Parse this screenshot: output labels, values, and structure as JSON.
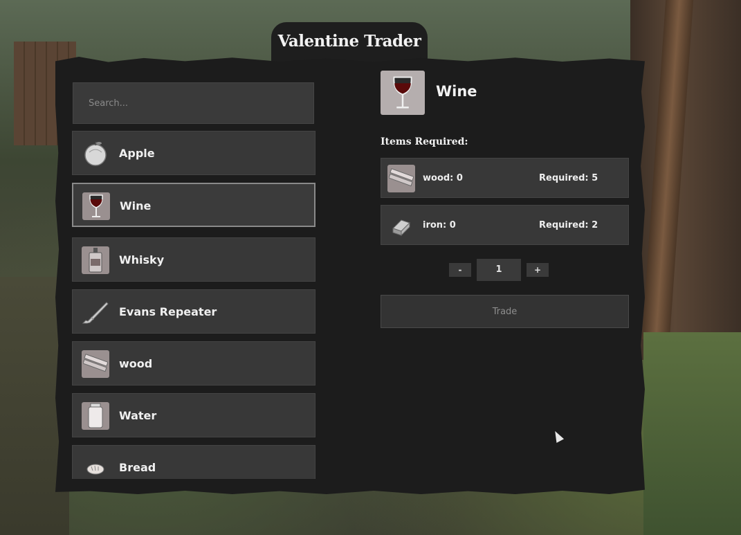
{
  "trader": {
    "title": "Valentine Trader"
  },
  "search": {
    "placeholder": "Search..."
  },
  "items": [
    {
      "name": "Apple",
      "icon": "apple-icon",
      "selected": false
    },
    {
      "name": "Wine",
      "icon": "wine-glass-icon",
      "selected": true
    },
    {
      "name": "Whisky",
      "icon": "whisky-bottle-icon",
      "selected": false
    },
    {
      "name": "Evans Repeater",
      "icon": "rifle-icon",
      "selected": false
    },
    {
      "name": "wood",
      "icon": "wood-planks-icon",
      "selected": false
    },
    {
      "name": "Water",
      "icon": "water-jar-icon",
      "selected": false
    },
    {
      "name": "Bread",
      "icon": "bread-icon",
      "selected": false
    }
  ],
  "detail": {
    "name": "Wine",
    "icon": "wine-glass-icon",
    "requirements_title": "Items Required:",
    "requirements": [
      {
        "icon": "wood-planks-icon",
        "have": "wood: 0",
        "need": "Required: 5"
      },
      {
        "icon": "iron-ingot-icon",
        "have": "iron: 0",
        "need": "Required: 2"
      }
    ],
    "quantity": "1",
    "minus_label": "-",
    "plus_label": "+",
    "trade_label": "Trade"
  },
  "colors": {
    "panel": "#1c1c1c",
    "row": "#383838",
    "selected_border": "#8a8a8a",
    "text": "#f0f0f0"
  }
}
